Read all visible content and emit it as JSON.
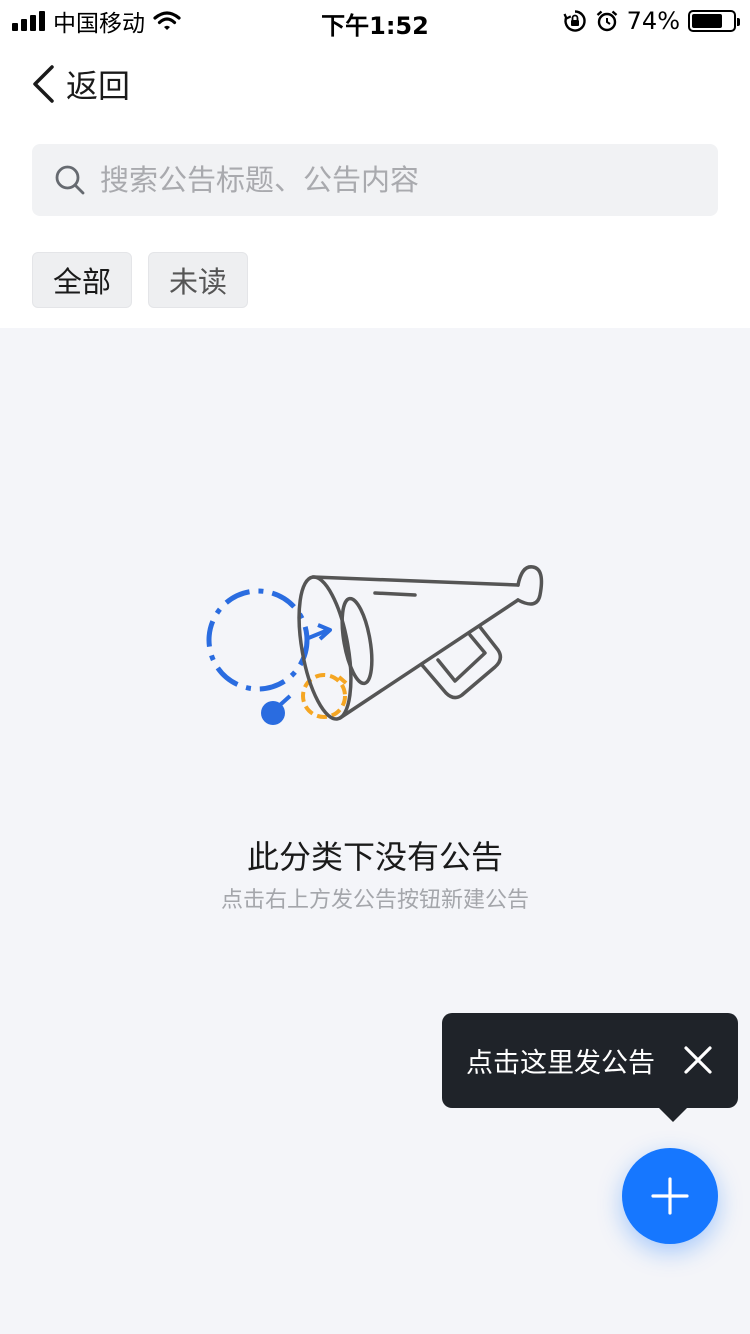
{
  "status_bar": {
    "carrier": "中国移动",
    "time": "下午1:52",
    "battery": "74%",
    "battery_level": 0.74
  },
  "nav": {
    "back_label": "返回"
  },
  "search": {
    "placeholder": "搜索公告标题、公告内容"
  },
  "filters": [
    {
      "label": "全部",
      "selected": true
    },
    {
      "label": "未读",
      "selected": false
    }
  ],
  "empty_state": {
    "title": "此分类下没有公告",
    "subtitle": "点击右上方发公告按钮新建公告"
  },
  "tooltip": {
    "text": "点击这里发公告"
  },
  "colors": {
    "accent": "#1677ff",
    "orange": "#f5a623",
    "tooltip_bg": "#1f2329",
    "page_bg": "#f4f5f9"
  }
}
